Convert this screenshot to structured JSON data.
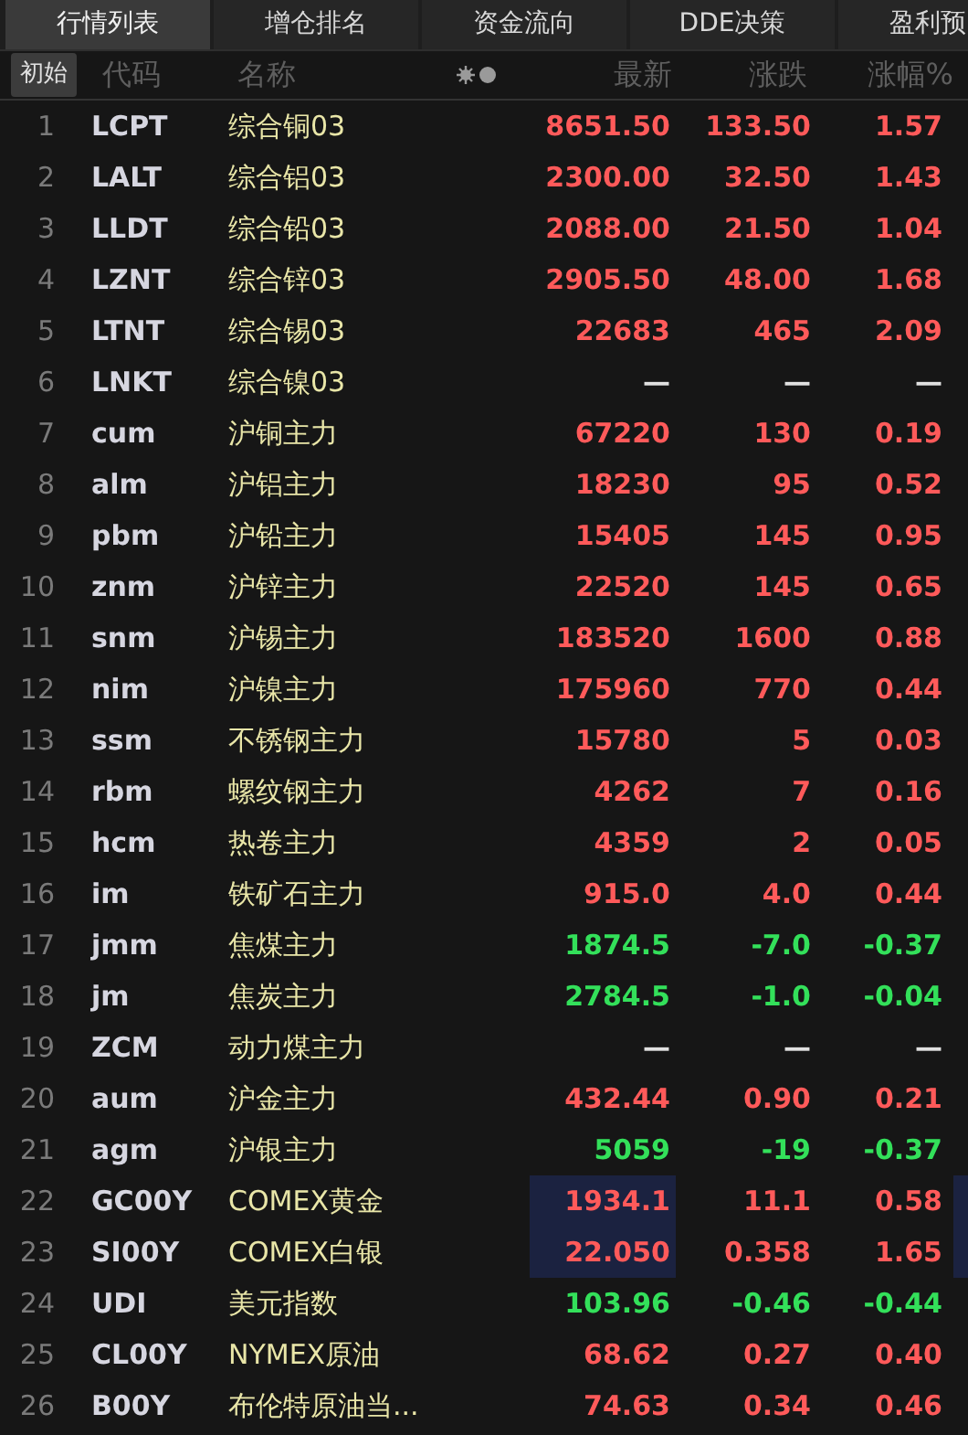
{
  "tabs": [
    {
      "label": "行情列表",
      "selected": true
    },
    {
      "label": "增仓排名",
      "selected": false
    },
    {
      "label": "资金流向",
      "selected": false
    },
    {
      "label": "DDE决策",
      "selected": false
    },
    {
      "label": "盈利预",
      "selected": false
    }
  ],
  "reset_button": "初始",
  "columns": [
    "代码",
    "名称",
    "最新",
    "涨跌",
    "涨幅%"
  ],
  "rows": [
    {
      "no": "1",
      "code": "LCPT",
      "name": "综合铜03",
      "last": "8651.50",
      "change": "133.50",
      "pct": "1.57",
      "color": "#ff5a5a",
      "highlighted": false
    },
    {
      "no": "2",
      "code": "LALT",
      "name": "综合铝03",
      "last": "2300.00",
      "change": "32.50",
      "pct": "1.43",
      "color": "#ff5a5a",
      "highlighted": false
    },
    {
      "no": "3",
      "code": "LLDT",
      "name": "综合铅03",
      "last": "2088.00",
      "change": "21.50",
      "pct": "1.04",
      "color": "#ff5a5a",
      "highlighted": false
    },
    {
      "no": "4",
      "code": "LZNT",
      "name": "综合锌03",
      "last": "2905.50",
      "change": "48.00",
      "pct": "1.68",
      "color": "#ff5a5a",
      "highlighted": false
    },
    {
      "no": "5",
      "code": "LTNT",
      "name": "综合锡03",
      "last": "22683",
      "change": "465",
      "pct": "2.09",
      "color": "#ff5a5a",
      "highlighted": false
    },
    {
      "no": "6",
      "code": "LNKT",
      "name": "综合镍03",
      "last": "—",
      "change": "—",
      "pct": "—",
      "color": "#e0e0e0",
      "highlighted": false
    },
    {
      "no": "7",
      "code": "cum",
      "name": "沪铜主力",
      "last": "67220",
      "change": "130",
      "pct": "0.19",
      "color": "#ff5a5a",
      "highlighted": false
    },
    {
      "no": "8",
      "code": "alm",
      "name": "沪铝主力",
      "last": "18230",
      "change": "95",
      "pct": "0.52",
      "color": "#ff5a5a",
      "highlighted": false
    },
    {
      "no": "9",
      "code": "pbm",
      "name": "沪铅主力",
      "last": "15405",
      "change": "145",
      "pct": "0.95",
      "color": "#ff5a5a",
      "highlighted": false
    },
    {
      "no": "10",
      "code": "znm",
      "name": "沪锌主力",
      "last": "22520",
      "change": "145",
      "pct": "0.65",
      "color": "#ff5a5a",
      "highlighted": false
    },
    {
      "no": "11",
      "code": "snm",
      "name": "沪锡主力",
      "last": "183520",
      "change": "1600",
      "pct": "0.88",
      "color": "#ff5a5a",
      "highlighted": false
    },
    {
      "no": "12",
      "code": "nim",
      "name": "沪镍主力",
      "last": "175960",
      "change": "770",
      "pct": "0.44",
      "color": "#ff5a5a",
      "highlighted": false
    },
    {
      "no": "13",
      "code": "ssm",
      "name": "不锈钢主力",
      "last": "15780",
      "change": "5",
      "pct": "0.03",
      "color": "#ff5a5a",
      "highlighted": false
    },
    {
      "no": "14",
      "code": "rbm",
      "name": "螺纹钢主力",
      "last": "4262",
      "change": "7",
      "pct": "0.16",
      "color": "#ff5a5a",
      "highlighted": false
    },
    {
      "no": "15",
      "code": "hcm",
      "name": "热卷主力",
      "last": "4359",
      "change": "2",
      "pct": "0.05",
      "color": "#ff5a5a",
      "highlighted": false
    },
    {
      "no": "16",
      "code": "im",
      "name": "铁矿石主力",
      "last": "915.0",
      "change": "4.0",
      "pct": "0.44",
      "color": "#ff5a5a",
      "highlighted": false
    },
    {
      "no": "17",
      "code": "jmm",
      "name": "焦煤主力",
      "last": "1874.5",
      "change": "-7.0",
      "pct": "-0.37",
      "color": "#33e05a",
      "highlighted": false
    },
    {
      "no": "18",
      "code": "jm",
      "name": "焦炭主力",
      "last": "2784.5",
      "change": "-1.0",
      "pct": "-0.04",
      "color": "#33e05a",
      "highlighted": false
    },
    {
      "no": "19",
      "code": "ZCM",
      "name": "动力煤主力",
      "last": "—",
      "change": "—",
      "pct": "—",
      "color": "#e0e0e0",
      "highlighted": false
    },
    {
      "no": "20",
      "code": "aum",
      "name": "沪金主力",
      "last": "432.44",
      "change": "0.90",
      "pct": "0.21",
      "color": "#ff5a5a",
      "highlighted": false
    },
    {
      "no": "21",
      "code": "agm",
      "name": "沪银主力",
      "last": "5059",
      "change": "-19",
      "pct": "-0.37",
      "color": "#33e05a",
      "highlighted": false
    },
    {
      "no": "22",
      "code": "GC00Y",
      "name": "COMEX黄金",
      "last": "1934.1",
      "change": "11.1",
      "pct": "0.58",
      "color": "#ff5a5a",
      "highlighted": true
    },
    {
      "no": "23",
      "code": "SI00Y",
      "name": "COMEX白银",
      "last": "22.050",
      "change": "0.358",
      "pct": "1.65",
      "color": "#ff5a5a",
      "highlighted": true
    },
    {
      "no": "24",
      "code": "UDI",
      "name": "美元指数",
      "last": "103.96",
      "change": "-0.46",
      "pct": "-0.44",
      "color": "#33e05a",
      "highlighted": false
    },
    {
      "no": "25",
      "code": "CL00Y",
      "name": "NYMEX原油",
      "last": "68.62",
      "change": "0.27",
      "pct": "0.40",
      "color": "#ff5a5a",
      "highlighted": false
    },
    {
      "no": "26",
      "code": "B00Y",
      "name": "布伦特原油当...",
      "last": "74.63",
      "change": "0.34",
      "pct": "0.46",
      "color": "#ff5a5a",
      "highlighted": false
    }
  ]
}
